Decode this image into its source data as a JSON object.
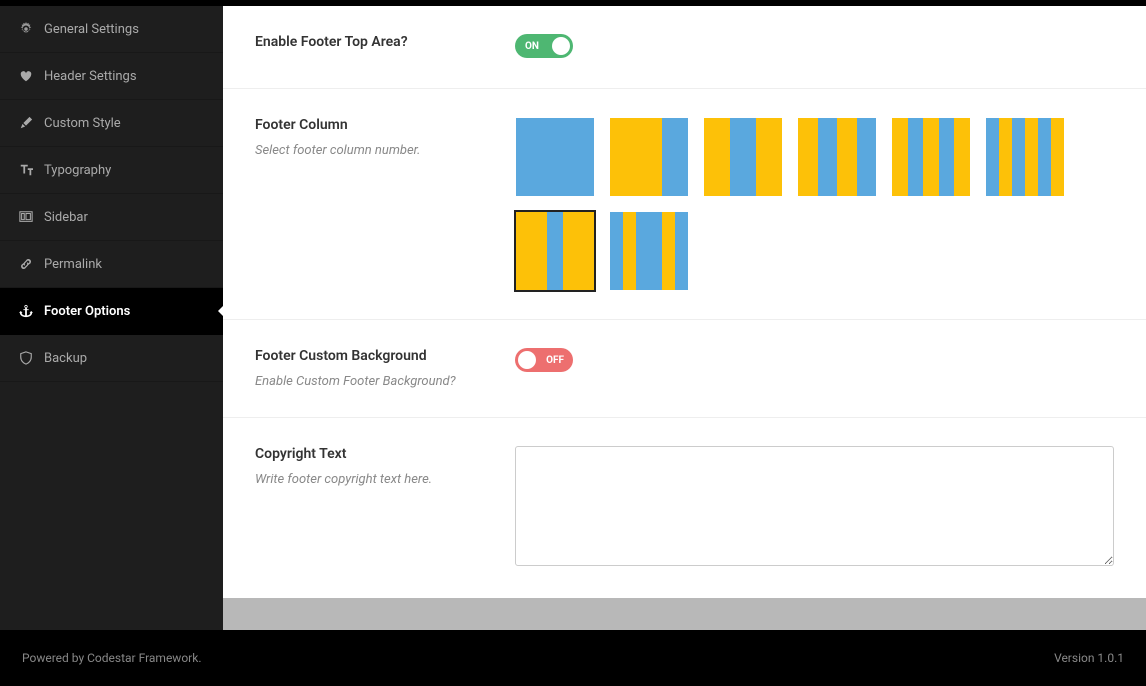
{
  "sidebar": {
    "items": [
      {
        "label": "General Settings"
      },
      {
        "label": "Header Settings"
      },
      {
        "label": "Custom Style"
      },
      {
        "label": "Typography"
      },
      {
        "label": "Sidebar"
      },
      {
        "label": "Permalink"
      },
      {
        "label": "Footer Options"
      },
      {
        "label": "Backup"
      }
    ]
  },
  "sections": {
    "enableFooterTop": {
      "title": "Enable Footer Top Area?",
      "toggle": "ON"
    },
    "footerColumn": {
      "title": "Footer Column",
      "desc": "Select footer column number."
    },
    "footerBg": {
      "title": "Footer Custom Background",
      "desc": "Enable Custom Footer Background?",
      "toggle": "OFF"
    },
    "copyright": {
      "title": "Copyright Text",
      "desc": "Write footer copyright text here.",
      "value": ""
    }
  },
  "footer": {
    "poweredPrefix": "Powered by ",
    "poweredLink": "Codestar Framework",
    "poweredSuffix": ".",
    "version": "Version 1.0.1"
  }
}
